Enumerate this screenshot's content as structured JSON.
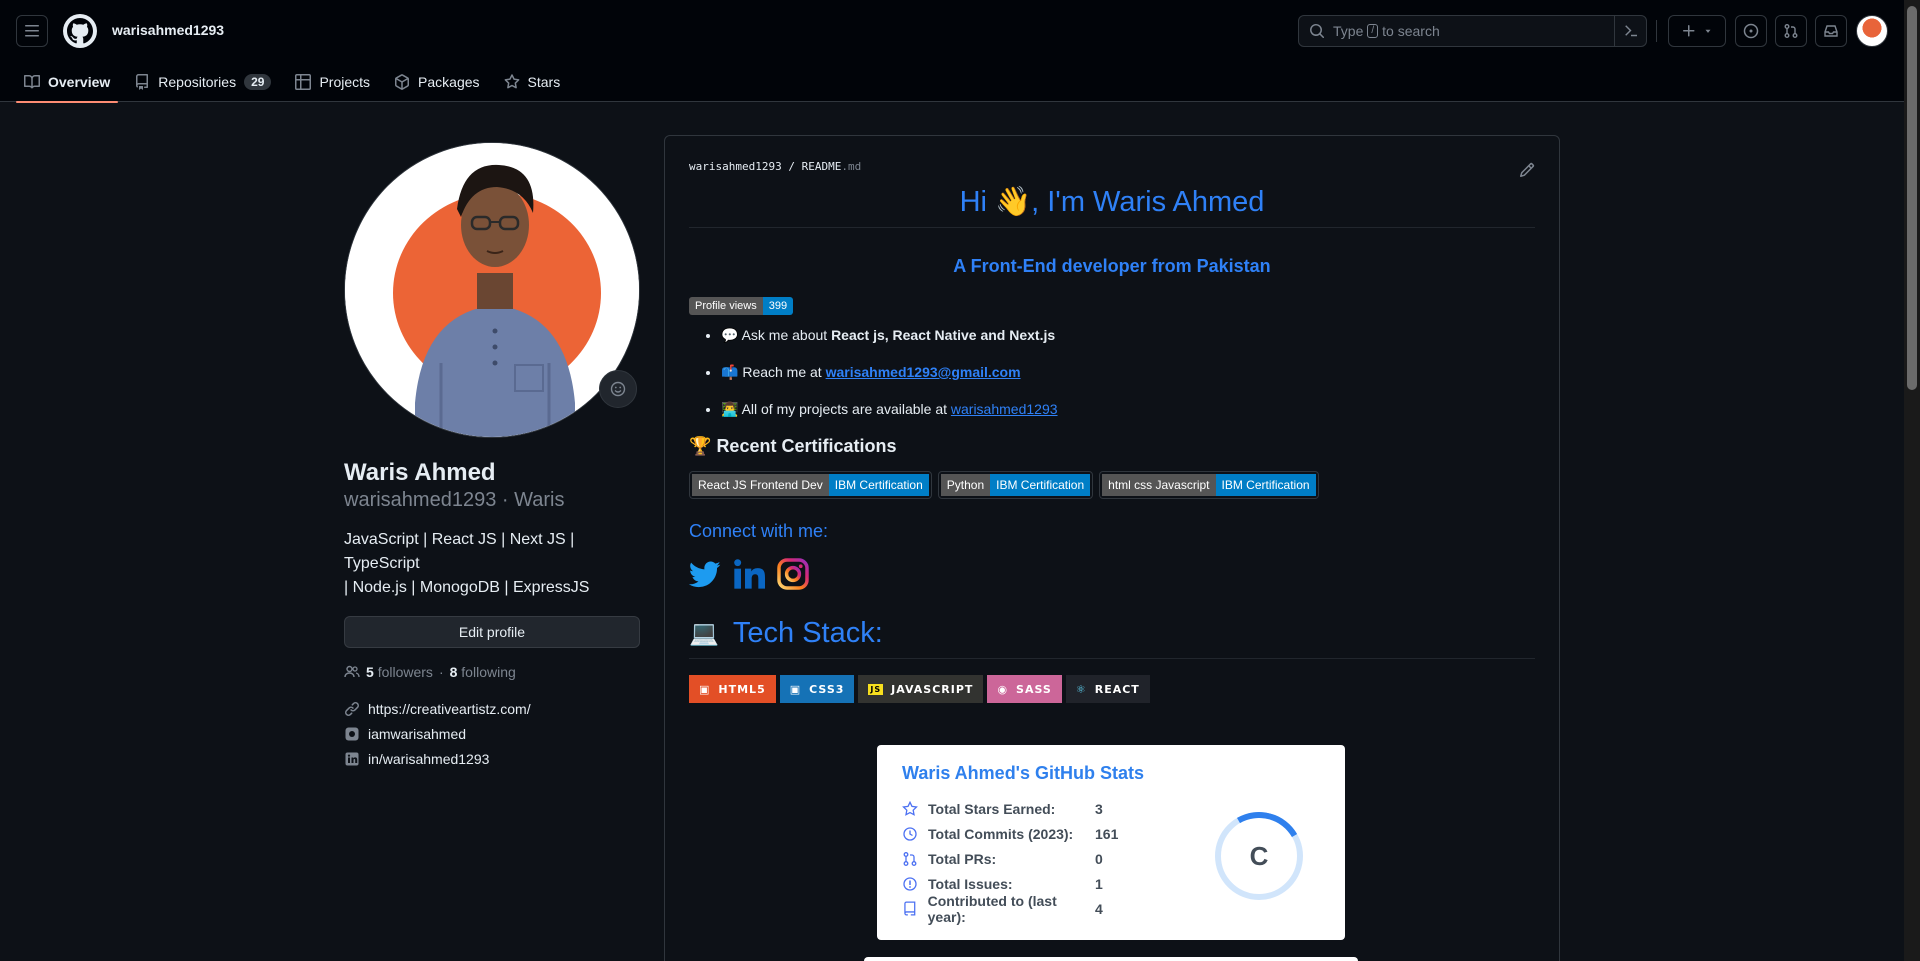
{
  "header": {
    "username": "warisahmed1293",
    "search_placeholder_pre": "Type",
    "search_slash": "/",
    "search_placeholder_post": "to search"
  },
  "tabs": [
    {
      "label": "Overview",
      "active": true
    },
    {
      "label": "Repositories",
      "count": "29"
    },
    {
      "label": "Projects"
    },
    {
      "label": "Packages"
    },
    {
      "label": "Stars"
    }
  ],
  "profile": {
    "name": "Waris Ahmed",
    "login": "warisahmed1293 · Waris",
    "bio_line1": "JavaScript | React JS | Next JS | TypeScript",
    "bio_line2": "| Node.js | MonogoDB | ExpressJS",
    "edit_label": "Edit profile",
    "followers": "5",
    "followers_label": "followers",
    "sep": "·",
    "following": "8",
    "following_label": "following",
    "website": "https://creativeartistz.com/",
    "social1": "iamwarisahmed",
    "linkedin": "in/warisahmed1293"
  },
  "readme": {
    "crumb_user": "warisahmed1293",
    "crumb_sep": "/",
    "crumb_file": "README",
    "crumb_ext": ".md",
    "title": "Hi 👋, I'm Waris Ahmed",
    "subtitle": "A Front-End developer from Pakistan",
    "views_label": "Profile views",
    "views_count": "399",
    "list": {
      "ask_icon": "💬",
      "ask_pre": "Ask me about",
      "ask_bold": "React js, React Native and Next.js",
      "reach_icon": "📫",
      "reach_pre": "Reach me at",
      "reach_email": "warisahmed1293@gmail.com",
      "projects_icon": "👨‍💻",
      "projects_pre": "All of my projects are available at",
      "projects_link": "warisahmed1293"
    },
    "cert_heading_icon": "🏆",
    "cert_heading": "Recent Certifications",
    "certs": [
      {
        "left": "React JS Frontend Dev",
        "right": "IBM Certification"
      },
      {
        "left": "Python",
        "right": "IBM Certification"
      },
      {
        "left": "html css Javascript",
        "right": "IBM Certification"
      }
    ],
    "connect_heading": "Connect with me:",
    "tech_icon": "💻",
    "tech_heading": "Tech Stack:",
    "tech": [
      {
        "label": "HTML5",
        "color": "#e34f26"
      },
      {
        "label": "CSS3",
        "color": "#1572b6"
      },
      {
        "label": "JAVASCRIPT",
        "color": "#323330"
      },
      {
        "label": "SASS",
        "color": "#cc6699"
      },
      {
        "label": "REACT",
        "color": "#20232a"
      }
    ]
  },
  "stats": {
    "title": "Waris Ahmed's GitHub Stats",
    "rows": [
      {
        "label": "Total Stars Earned:",
        "value": "3",
        "icon": "star-icon"
      },
      {
        "label": "Total Commits (2023):",
        "value": "161",
        "icon": "history-icon"
      },
      {
        "label": "Total PRs:",
        "value": "0",
        "icon": "pr-icon"
      },
      {
        "label": "Total Issues:",
        "value": "1",
        "icon": "issue-icon"
      },
      {
        "label": "Contributed to (last year):",
        "value": "4",
        "icon": "repo-icon"
      }
    ],
    "grade": "C"
  },
  "colors": {
    "accent": "#2f81f7",
    "tab_underline": "#fd8c73",
    "background": "#0d1117"
  }
}
